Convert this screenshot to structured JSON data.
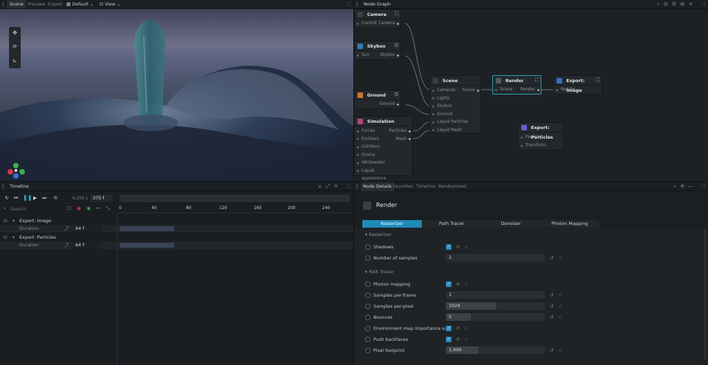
{
  "scene_tabs": [
    "Scene",
    "Preview",
    "Export"
  ],
  "scene_toolbar": {
    "layout": "Default",
    "view": "View"
  },
  "node_graph": {
    "title": "Node Graph",
    "nodes": {
      "camera": {
        "title": "Camera",
        "in": "Control",
        "out": "Camera"
      },
      "skybox": {
        "title": "Skybox",
        "in": "Sun",
        "out": "Skybox"
      },
      "ground": {
        "title": "Ground",
        "out": "Ground"
      },
      "simulation": {
        "title": "Simulation",
        "inputs": [
          "Forces",
          "Emitters",
          "Colliders",
          "Drains",
          "Whitewater",
          "Liquid appearance"
        ],
        "outputs": [
          "Particles",
          "Mesh"
        ]
      },
      "scene": {
        "title": "Scene",
        "inputs": [
          "Cameras",
          "Lights",
          "Skybox",
          "Ground",
          "Liquid Particles",
          "Liquid Mesh"
        ],
        "out": "Scene"
      },
      "render": {
        "title": "Render",
        "in": "Scene",
        "out": "Render"
      },
      "export_image": {
        "title": "Export: Image",
        "in": "Render"
      },
      "export_particles": {
        "title": "Export: Particles",
        "inputs": [
          "Particles",
          "Transform"
        ]
      }
    }
  },
  "timeline": {
    "title": "Timeline",
    "time": "6.250 s",
    "frame": "375 f",
    "search_placeholder": "Search",
    "ruler": [
      "0",
      "40",
      "80",
      "120",
      "160",
      "200",
      "240"
    ],
    "tracks": [
      {
        "name": "Export: Image",
        "param": "Duration",
        "value": "64 f"
      },
      {
        "name": "Export: Particles",
        "param": "Duration",
        "value": "64 f"
      }
    ]
  },
  "details": {
    "tabs": [
      "Node Details",
      "Favorites",
      "Timeline",
      "Randomized"
    ],
    "node_title": "Render",
    "subtabs": [
      "Rasterizer",
      "Path Tracer",
      "Denoiser",
      "Photon Mapping"
    ],
    "sections": [
      {
        "title": "Rasterizer",
        "props": [
          {
            "label": "Shadows",
            "type": "check"
          },
          {
            "label": "Number of samples",
            "type": "field",
            "value": "1",
            "fill": 0
          }
        ]
      },
      {
        "title": "Path Tracer",
        "props": [
          {
            "label": "Photon mapping",
            "type": "check"
          },
          {
            "label": "Samples per-frame",
            "type": "field",
            "value": "1",
            "fill": 0
          },
          {
            "label": "Samples per-pixel",
            "type": "field",
            "value": "1024",
            "fill": 0.5
          },
          {
            "label": "Bounces",
            "type": "field",
            "value": "5",
            "fill": 0.25
          },
          {
            "label": "Environment map importance sa",
            "type": "check"
          },
          {
            "label": "Push backfaces",
            "type": "check"
          },
          {
            "label": "Pixel footprint",
            "type": "field",
            "value": "1.000",
            "fill": 0.33
          }
        ]
      }
    ]
  },
  "colors": {
    "accent": "#1f8ab8",
    "selected_node": "#2aa6c9"
  }
}
